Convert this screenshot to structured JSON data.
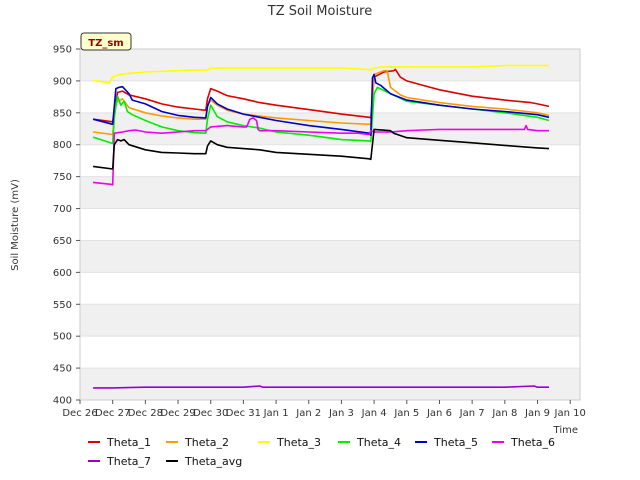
{
  "chart_data": {
    "type": "line",
    "title": "TZ Soil Moisture",
    "xlabel": "Time",
    "ylabel": "Soil Moisture (mV)",
    "site_label": "TZ_sm",
    "xlim": [
      0,
      15.3
    ],
    "ylim": [
      400,
      950
    ],
    "yticks": [
      400,
      450,
      500,
      550,
      600,
      650,
      700,
      750,
      800,
      850,
      900,
      950
    ],
    "xticks": [
      {
        "label": "Dec 26",
        "x": 0
      },
      {
        "label": "Dec 27",
        "x": 1
      },
      {
        "label": "Dec 28",
        "x": 2
      },
      {
        "label": "Dec 29",
        "x": 3
      },
      {
        "label": "Dec 30",
        "x": 4
      },
      {
        "label": "Dec 31",
        "x": 5
      },
      {
        "label": "Jan 1",
        "x": 6
      },
      {
        "label": "Jan 2",
        "x": 7
      },
      {
        "label": "Jan 3",
        "x": 8
      },
      {
        "label": "Jan 4",
        "x": 9
      },
      {
        "label": "Jan 5",
        "x": 10
      },
      {
        "label": "Jan 6",
        "x": 11
      },
      {
        "label": "Jan 7",
        "x": 12
      },
      {
        "label": "Jan 8",
        "x": 13
      },
      {
        "label": "Jan 9",
        "x": 14
      },
      {
        "label": "Jan 10",
        "x": 15
      }
    ],
    "grid": "alternating horizontal bands",
    "legend_position": "bottom",
    "series": [
      {
        "name": "Theta_1",
        "color": "#dd0000",
        "x": [
          0.4,
          1.0,
          1.15,
          1.3,
          1.5,
          2.0,
          2.5,
          3.0,
          3.5,
          3.85,
          3.9,
          4.0,
          4.2,
          4.5,
          5.0,
          5.5,
          6.0,
          7.0,
          8.0,
          8.85,
          8.9,
          9.0,
          9.3,
          9.6,
          9.65,
          9.8,
          10.0,
          10.5,
          11.0,
          12.0,
          13.0,
          13.8,
          14.0,
          14.35
        ],
        "y": [
          840,
          836,
          882,
          884,
          878,
          872,
          864,
          859,
          856,
          854,
          872,
          888,
          884,
          877,
          872,
          866,
          862,
          855,
          848,
          843,
          842,
          906,
          914,
          916,
          918,
          906,
          900,
          893,
          886,
          876,
          870,
          866,
          864,
          860
        ]
      },
      {
        "name": "Theta_2",
        "color": "#ff9900",
        "x": [
          0.4,
          1.0,
          1.1,
          1.3,
          1.5,
          2.0,
          2.5,
          3.0,
          3.5,
          3.85,
          3.9,
          4.0,
          4.2,
          4.5,
          5.0,
          5.5,
          6.0,
          7.0,
          8.0,
          8.85,
          8.9,
          9.0,
          9.3,
          9.4,
          9.5,
          9.8,
          10.0,
          10.5,
          11.0,
          12.0,
          13.0,
          14.0,
          14.35
        ],
        "y": [
          820,
          816,
          866,
          872,
          858,
          850,
          845,
          842,
          840,
          840,
          860,
          870,
          862,
          854,
          848,
          845,
          842,
          838,
          834,
          832,
          831,
          910,
          916,
          916,
          890,
          878,
          874,
          870,
          866,
          860,
          856,
          850,
          846
        ]
      },
      {
        "name": "Theta_3",
        "color": "#ffff00",
        "x": [
          0.4,
          0.9,
          1.0,
          1.2,
          1.5,
          2.0,
          2.5,
          3.0,
          3.5,
          3.85,
          3.9,
          4.0,
          5.0,
          6.0,
          7.0,
          8.0,
          8.8,
          8.9,
          9.0,
          9.2,
          9.5,
          10.0,
          11.0,
          12.0,
          13.0,
          14.0,
          14.35
        ],
        "y": [
          901,
          897,
          906,
          910,
          912,
          914,
          915,
          916,
          917,
          917,
          917,
          920,
          920,
          920,
          920,
          920,
          918,
          917,
          920,
          922,
          922,
          922,
          922,
          922,
          924,
          924,
          924
        ]
      },
      {
        "name": "Theta_4",
        "color": "#00ee00",
        "x": [
          0.4,
          1.0,
          1.05,
          1.15,
          1.25,
          1.35,
          1.45,
          1.6,
          2.0,
          2.5,
          3.0,
          3.5,
          3.85,
          3.9,
          4.0,
          4.2,
          4.5,
          5.0,
          5.5,
          6.0,
          7.0,
          8.0,
          8.85,
          8.9,
          9.0,
          9.1,
          9.3,
          9.5,
          10.0,
          11.0,
          12.0,
          13.0,
          14.0,
          14.35
        ],
        "y": [
          812,
          802,
          845,
          876,
          862,
          868,
          852,
          847,
          838,
          828,
          822,
          819,
          818,
          840,
          862,
          844,
          836,
          830,
          826,
          820,
          815,
          808,
          806,
          805,
          880,
          890,
          885,
          880,
          868,
          862,
          856,
          850,
          843,
          838
        ]
      },
      {
        "name": "Theta_5",
        "color": "#0000cc",
        "x": [
          0.4,
          1.0,
          1.1,
          1.2,
          1.3,
          1.5,
          1.6,
          2.0,
          2.5,
          3.0,
          3.5,
          3.85,
          3.9,
          4.0,
          4.2,
          4.5,
          5.0,
          5.5,
          6.0,
          7.0,
          8.0,
          8.85,
          8.9,
          8.95,
          9.0,
          9.05,
          9.2,
          9.5,
          10.0,
          11.0,
          12.0,
          13.0,
          14.0,
          14.35
        ],
        "y": [
          840,
          832,
          888,
          890,
          891,
          880,
          870,
          864,
          852,
          846,
          843,
          842,
          860,
          874,
          864,
          856,
          848,
          843,
          838,
          830,
          824,
          818,
          815,
          905,
          910,
          897,
          893,
          880,
          870,
          862,
          856,
          852,
          847,
          843
        ]
      },
      {
        "name": "Theta_6",
        "color": "#ee00ee",
        "x": [
          0.4,
          0.95,
          1.0,
          1.05,
          1.3,
          1.5,
          1.7,
          2.0,
          2.5,
          3.0,
          3.5,
          3.85,
          3.95,
          4.0,
          4.5,
          5.0,
          5.1,
          5.2,
          5.3,
          5.4,
          5.45,
          5.5,
          6.0,
          7.0,
          8.0,
          8.5,
          8.85,
          8.9,
          9.0,
          9.5,
          10.0,
          10.5,
          11.0,
          12.0,
          13.0,
          13.6,
          13.65,
          13.7,
          14.0,
          14.35
        ],
        "y": [
          741,
          738,
          737,
          818,
          820,
          822,
          823,
          820,
          818,
          820,
          822,
          822,
          826,
          828,
          830,
          828,
          828,
          840,
          842,
          838,
          824,
          822,
          822,
          820,
          818,
          818,
          816,
          822,
          820,
          820,
          822,
          823,
          824,
          824,
          824,
          824,
          830,
          824,
          822,
          822
        ]
      },
      {
        "name": "Theta_7",
        "color": "#9900cc",
        "x": [
          0.4,
          1.0,
          2.0,
          3.0,
          4.0,
          5.0,
          5.5,
          5.6,
          6.0,
          7.0,
          8.0,
          9.0,
          10.0,
          11.0,
          12.0,
          13.0,
          13.9,
          14.0,
          14.35
        ],
        "y": [
          419,
          419,
          420,
          420,
          420,
          420,
          422,
          420,
          420,
          420,
          420,
          420,
          420,
          420,
          420,
          420,
          422,
          420,
          420
        ]
      },
      {
        "name": "Theta_avg",
        "color": "#000000",
        "x": [
          0.4,
          1.0,
          1.05,
          1.15,
          1.25,
          1.35,
          1.5,
          2.0,
          2.5,
          3.0,
          3.5,
          3.85,
          3.9,
          4.0,
          4.2,
          4.5,
          5.0,
          5.5,
          6.0,
          7.0,
          8.0,
          8.85,
          8.9,
          9.0,
          9.5,
          9.6,
          10.0,
          11.0,
          12.0,
          13.0,
          14.0,
          14.35
        ],
        "y": [
          766,
          762,
          800,
          808,
          806,
          808,
          800,
          792,
          788,
          787,
          786,
          786,
          798,
          806,
          800,
          796,
          794,
          792,
          788,
          785,
          782,
          778,
          777,
          824,
          822,
          818,
          811,
          807,
          803,
          799,
          795,
          794
        ]
      }
    ]
  }
}
